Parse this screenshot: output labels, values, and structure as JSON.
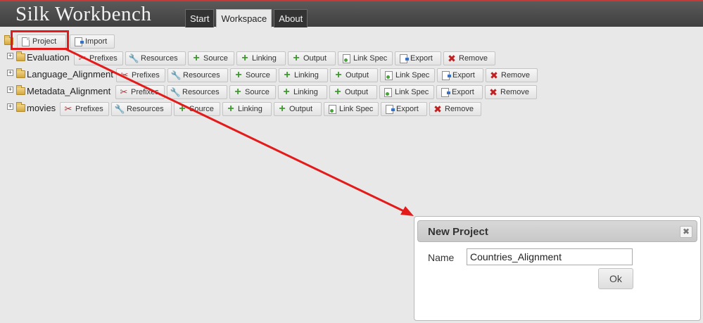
{
  "header": {
    "app_title": "Silk Workbench",
    "tabs": [
      {
        "label": "Start",
        "active": false
      },
      {
        "label": "Workspace",
        "active": true
      },
      {
        "label": "About",
        "active": false
      }
    ]
  },
  "toolbar": {
    "project_label": "Project",
    "import_label": "Import"
  },
  "action_labels": {
    "prefixes": "Prefixes",
    "resources": "Resources",
    "source": "Source",
    "linking": "Linking",
    "output": "Output",
    "link_spec": "Link Spec",
    "export": "Export",
    "remove": "Remove"
  },
  "projects": [
    {
      "name": "Evaluation"
    },
    {
      "name": "Language_Alignment"
    },
    {
      "name": "Metadata_Alignment"
    },
    {
      "name": "movies"
    }
  ],
  "dialog": {
    "title": "New Project",
    "name_label": "Name",
    "name_value": "Countries_Alignment",
    "ok_label": "Ok",
    "close_glyph": "✖"
  },
  "colors": {
    "annotation_red": "#e41b1b",
    "header_bg": "#4a4a4a",
    "accent_green": "#3a9a2a",
    "remove_red": "#c02020"
  }
}
